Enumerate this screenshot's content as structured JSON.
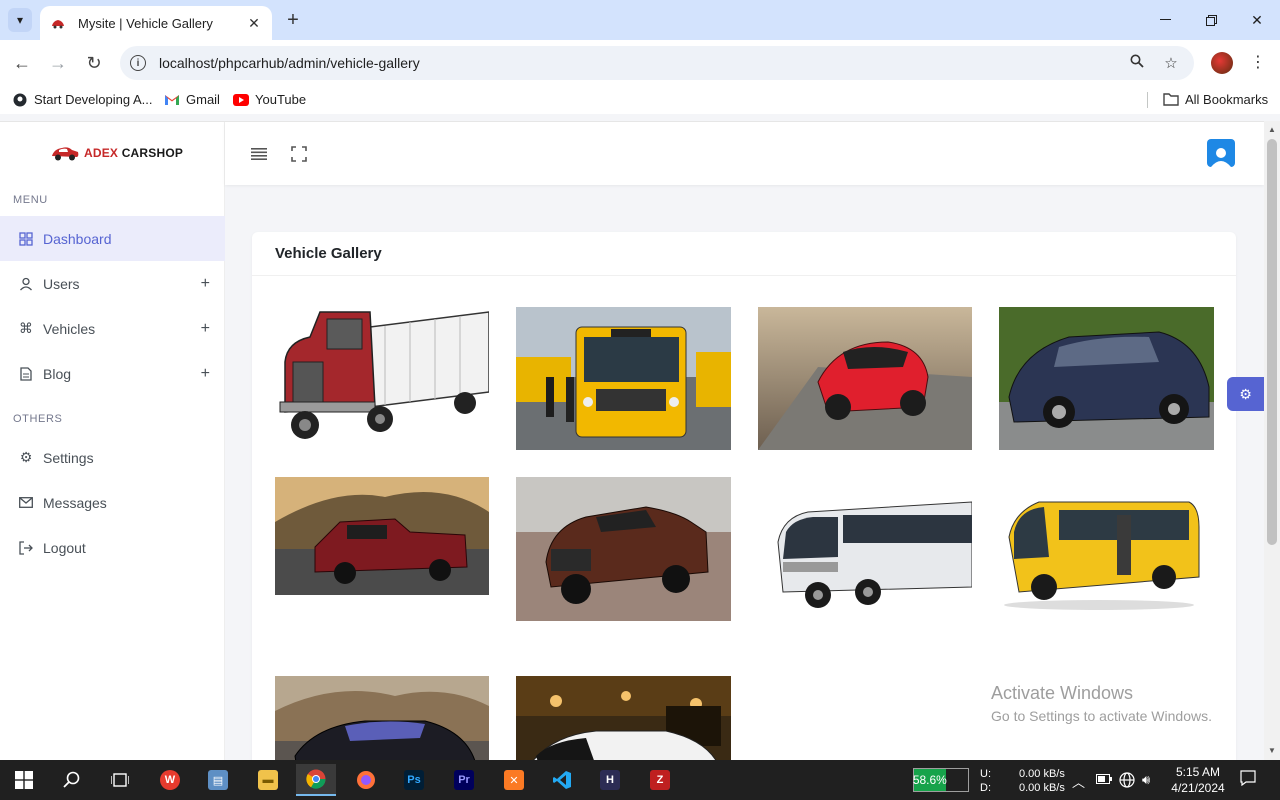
{
  "browser": {
    "tab_title": "Mysite | Vehicle Gallery",
    "url": "localhost/phpcarhub/admin/vehicle-gallery",
    "bookmarks": [
      {
        "label": "Start Developing A...",
        "icon": "github-icon"
      },
      {
        "label": "Gmail",
        "icon": "gmail-icon"
      },
      {
        "label": "YouTube",
        "icon": "youtube-icon"
      }
    ],
    "all_bookmarks": "All Bookmarks"
  },
  "sidebar": {
    "brand_part1": "ADEX",
    "brand_part2": "CARSHOP",
    "menu_heading": "MENU",
    "others_heading": "OTHERS",
    "items": [
      {
        "label": "Dashboard",
        "icon": "dashboard-grid-icon",
        "active": true
      },
      {
        "label": "Users",
        "icon": "user-icon",
        "expandable": true
      },
      {
        "label": "Vehicles",
        "icon": "command-icon",
        "expandable": true
      },
      {
        "label": "Blog",
        "icon": "document-icon",
        "expandable": true
      },
      {
        "label": "Settings",
        "icon": "gear-icon"
      },
      {
        "label": "Messages",
        "icon": "mail-icon"
      },
      {
        "label": "Logout",
        "icon": "logout-icon"
      }
    ]
  },
  "main": {
    "card_title": "Vehicle Gallery",
    "gallery": [
      "red semi truck",
      "yellow school bus",
      "red hatchback car",
      "dark blue luxury sedan",
      "red pickup truck",
      "brown pickup truck",
      "white coach bus",
      "yellow school bus",
      "black luxury sedan",
      "white hypercar"
    ]
  },
  "watermark": {
    "line1": "Activate Windows",
    "line2": "Go to Settings to activate Windows."
  },
  "taskbar": {
    "battery": "58.6%",
    "battery_level": 0.586,
    "net_upload_label": "U:",
    "net_download_label": "D:",
    "net_upload": "0.00 kB/s",
    "net_download": "0.00 kB/s",
    "time": "5:15 AM",
    "date": "4/21/2024",
    "colors": {
      "accent": "#76b9ed",
      "battery": "#16a34a"
    }
  },
  "colors": {
    "primary": "#5664d2",
    "active_bg": "#ebecfb",
    "user_btn": "#1e88e5"
  }
}
